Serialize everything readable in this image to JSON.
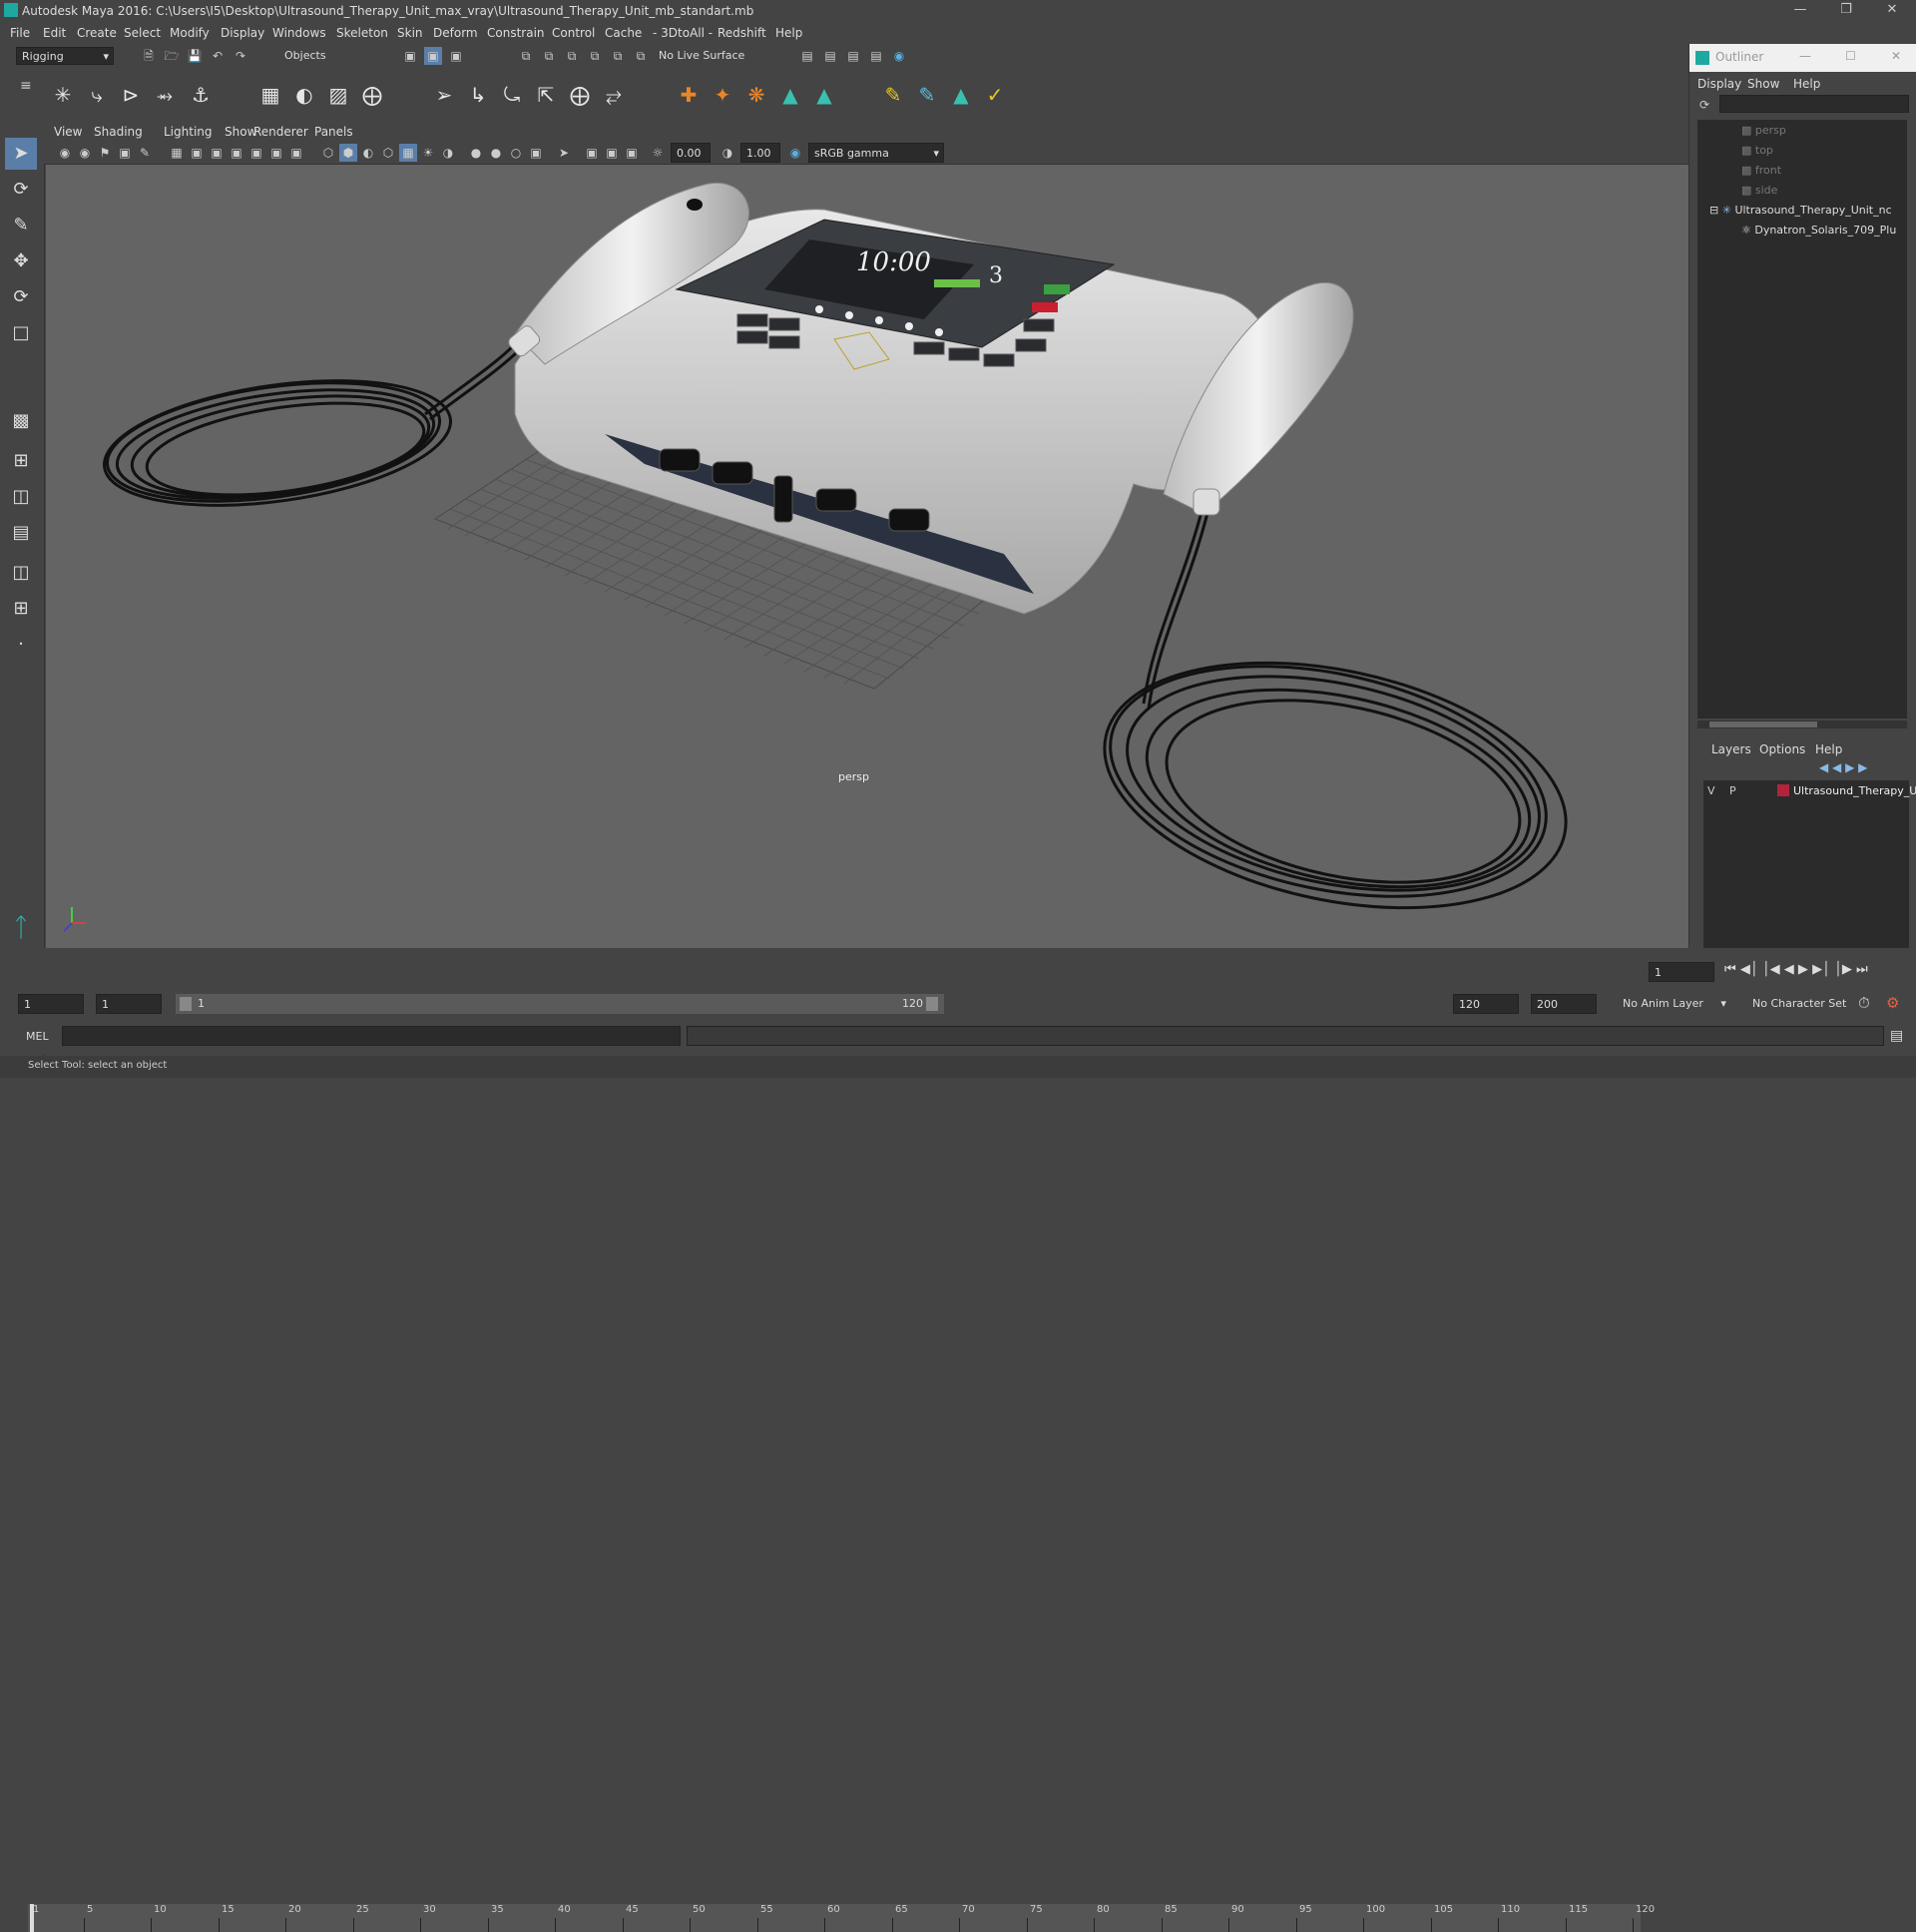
{
  "window": {
    "title": "Autodesk Maya 2016: C:\\Users\\I5\\Desktop\\Ultrasound_Therapy_Unit_max_vray\\Ultrasound_Therapy_Unit_mb_standart.mb"
  },
  "menubar": [
    "File",
    "Edit",
    "Create",
    "Select",
    "Modify",
    "Display",
    "Windows",
    "Skeleton",
    "Skin",
    "Deform",
    "Constrain",
    "Control",
    "Cache",
    "- 3DtoAll -",
    "Redshift",
    "Help"
  ],
  "statusline": {
    "mode": "Rigging",
    "selection": "Objects",
    "live_surface": "No Live Surface"
  },
  "viewport": {
    "menu": [
      "View",
      "Shading",
      "Lighting",
      "Show",
      "Renderer",
      "Panels"
    ],
    "exposure": "0.00",
    "gamma": "1.00",
    "color_space": "sRGB gamma",
    "camera_label": "persp",
    "device_screen": {
      "time": "10:00",
      "level": "3"
    }
  },
  "outliner": {
    "title": "Outliner",
    "menu": [
      "Display",
      "Show",
      "Help"
    ],
    "items": [
      {
        "label": "persp",
        "dim": true,
        "indent": 0
      },
      {
        "label": "top",
        "dim": true,
        "indent": 0
      },
      {
        "label": "front",
        "dim": true,
        "indent": 0
      },
      {
        "label": "side",
        "dim": true,
        "indent": 0
      },
      {
        "label": "Ultrasound_Therapy_Unit_nc",
        "dim": false,
        "indent": 0
      },
      {
        "label": "Dynatron_Solaris_709_Plu",
        "dim": false,
        "indent": 1
      }
    ]
  },
  "layers": {
    "menu": [
      "Layers",
      "Options",
      "Help"
    ],
    "row": {
      "v": "V",
      "p": "P",
      "name": "Ultrasound_Therapy_U",
      "color": "#b3243c"
    }
  },
  "timeline": {
    "ticks": [
      "1",
      "5",
      "10",
      "15",
      "20",
      "25",
      "30",
      "35",
      "40",
      "45",
      "50",
      "55",
      "60",
      "65",
      "70",
      "75",
      "80",
      "85",
      "90",
      "95",
      "100",
      "105",
      "110",
      "115",
      "120"
    ],
    "current_frame": "1"
  },
  "range": {
    "start": "1",
    "start_inner": "1",
    "slider_start": "1",
    "slider_end": "120",
    "end_inner": "120",
    "end": "200",
    "anim_layer": "No Anim Layer",
    "character_set": "No Character Set"
  },
  "mel": {
    "label": "MEL"
  },
  "help_line": "Select Tool: select an object"
}
